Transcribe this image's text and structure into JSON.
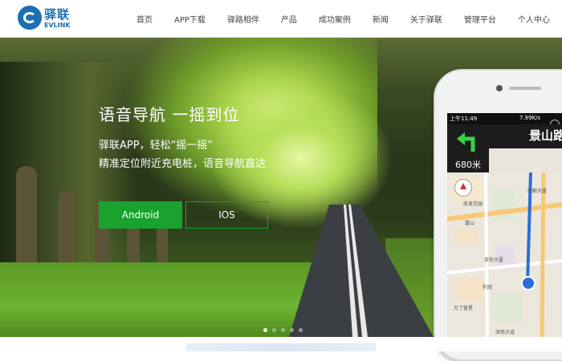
{
  "nav": {
    "logo": {
      "cn": "驿联",
      "en": "EVLINK"
    },
    "items": [
      {
        "label": "首页"
      },
      {
        "label": "APP下载"
      },
      {
        "label": "驿路相伴"
      },
      {
        "label": "产品"
      },
      {
        "label": "成功案例"
      },
      {
        "label": "新闻"
      },
      {
        "label": "关于驿联"
      },
      {
        "label": "管理平台"
      },
      {
        "label": "个人中心"
      }
    ]
  },
  "hero": {
    "title": "语音导航  一摇到位",
    "line1": "驿联APP，轻松“摇一摇”",
    "line2": "精准定位附近充电桩，语音导航直达",
    "buttons": {
      "android": "Android",
      "ios": "IOS"
    },
    "slides": {
      "count": 5,
      "active_index": 0
    }
  },
  "phone": {
    "status": {
      "time": "上午11:49",
      "network": "7.99K/s"
    },
    "turn_distance": "680米",
    "road_name": "景山路",
    "pois": [
      "丽都大厦",
      "凯发花园",
      "富山",
      "亚伯大厦",
      "利琏",
      "万丁暂星",
      "深南大道"
    ]
  },
  "colors": {
    "brand_blue": "#1c6fb5",
    "accent_green": "#1aa22e",
    "route_blue": "#2a6fd8"
  }
}
